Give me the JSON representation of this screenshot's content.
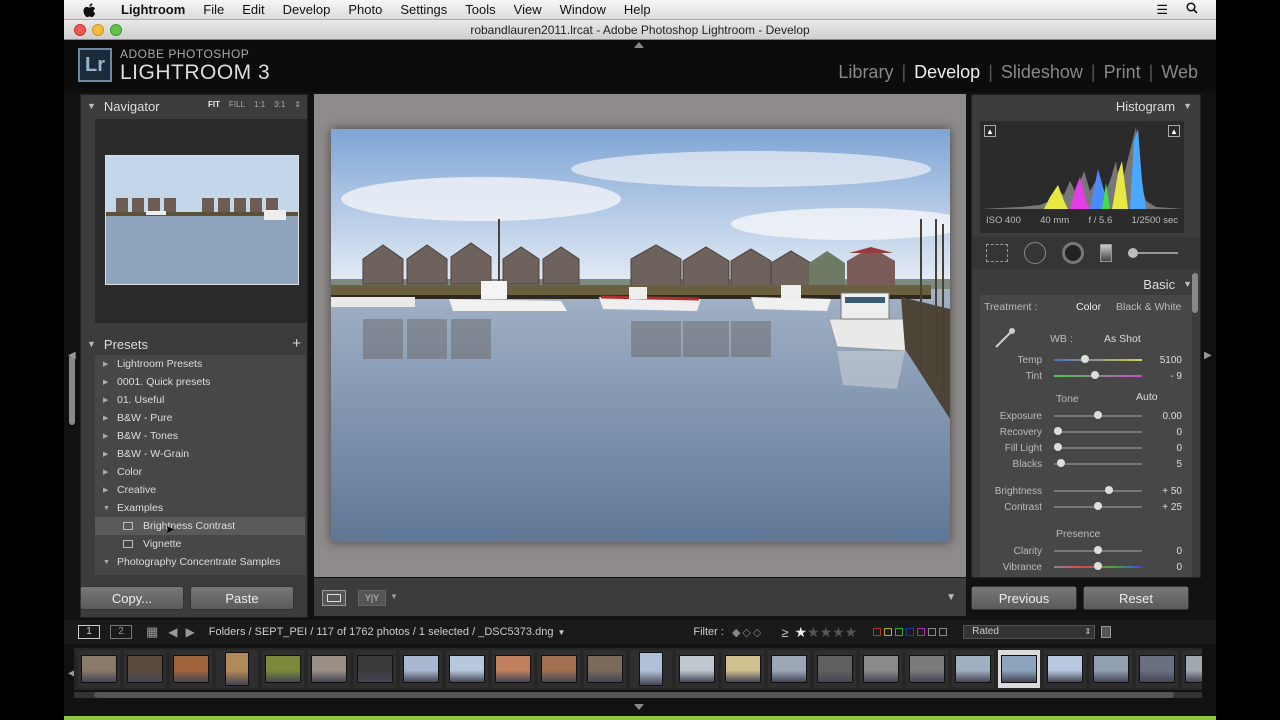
{
  "menubar": {
    "app_name": "Lightroom",
    "items": [
      "File",
      "Edit",
      "Develop",
      "Photo",
      "Settings",
      "Tools",
      "View",
      "Window",
      "Help"
    ]
  },
  "window": {
    "title": "robandlauren2011.lrcat - Adobe Photoshop Lightroom - Develop"
  },
  "identity": {
    "subtitle": "ADOBE PHOTOSHOP",
    "name": "LIGHTROOM 3",
    "logo": "Lr"
  },
  "modules": [
    "Library",
    "Develop",
    "Slideshow",
    "Print",
    "Web"
  ],
  "active_module": "Develop",
  "navigator": {
    "title": "Navigator",
    "options": [
      "FIT",
      "FILL",
      "1:1",
      "3:1"
    ],
    "active_option": "FIT"
  },
  "presets": {
    "title": "Presets",
    "items": [
      {
        "label": "Lightroom Presets",
        "state": "collapsed"
      },
      {
        "label": "0001. Quick presets",
        "state": "collapsed"
      },
      {
        "label": "01. Useful",
        "state": "collapsed"
      },
      {
        "label": "B&W - Pure",
        "state": "collapsed"
      },
      {
        "label": "B&W - Tones",
        "state": "collapsed"
      },
      {
        "label": "B&W - W-Grain",
        "state": "collapsed"
      },
      {
        "label": "Color",
        "state": "collapsed"
      },
      {
        "label": "Creative",
        "state": "collapsed"
      },
      {
        "label": "Examples",
        "state": "expanded"
      },
      {
        "label": "Brightness Contrast",
        "state": "leaf"
      },
      {
        "label": "Vignette",
        "state": "leaf"
      },
      {
        "label": "Photography Concentrate Samples",
        "state": "expanded"
      }
    ]
  },
  "left_buttons": {
    "copy": "Copy...",
    "paste": "Paste"
  },
  "right_buttons": {
    "previous": "Previous",
    "reset": "Reset"
  },
  "histogram": {
    "title": "Histogram",
    "iso": "ISO 400",
    "focal": "40 mm",
    "aperture": "f / 5.6",
    "shutter": "1/2500 sec"
  },
  "basic": {
    "title": "Basic",
    "treatment_label": "Treatment :",
    "treatment_color": "Color",
    "treatment_bw": "Black & White",
    "wb_label": "WB :",
    "wb_value": "As Shot",
    "tone_label": "Tone",
    "tone_auto": "Auto",
    "presence_label": "Presence",
    "sliders": [
      {
        "label": "Temp",
        "value": "5100",
        "pos": 0.35
      },
      {
        "label": "Tint",
        "value": "- 9",
        "pos": 0.47
      },
      {
        "label": "Exposure",
        "value": "0.00",
        "pos": 0.5
      },
      {
        "label": "Recovery",
        "value": "0",
        "pos": 0.0
      },
      {
        "label": "Fill Light",
        "value": "0",
        "pos": 0.0
      },
      {
        "label": "Blacks",
        "value": "5",
        "pos": 0.05
      },
      {
        "label": "Brightness",
        "value": "+ 50",
        "pos": 0.62
      },
      {
        "label": "Contrast",
        "value": "+ 25",
        "pos": 0.5
      },
      {
        "label": "Clarity",
        "value": "0",
        "pos": 0.5
      },
      {
        "label": "Vibrance",
        "value": "0",
        "pos": 0.5
      }
    ]
  },
  "filmstrip_nav": {
    "view1": "1",
    "view2": "2",
    "path": "Folders / SEPT_PEI / 117 of 1762 photos / 1 selected / _DSC5373.dng",
    "filter_label": "Filter :",
    "rating_op": "≥",
    "filter_value": "Rated"
  },
  "filmstrip_count": 28,
  "colors": {
    "panel": "#3c3c3c",
    "dark": "#111111",
    "center_bg": "#8f8b8a"
  }
}
